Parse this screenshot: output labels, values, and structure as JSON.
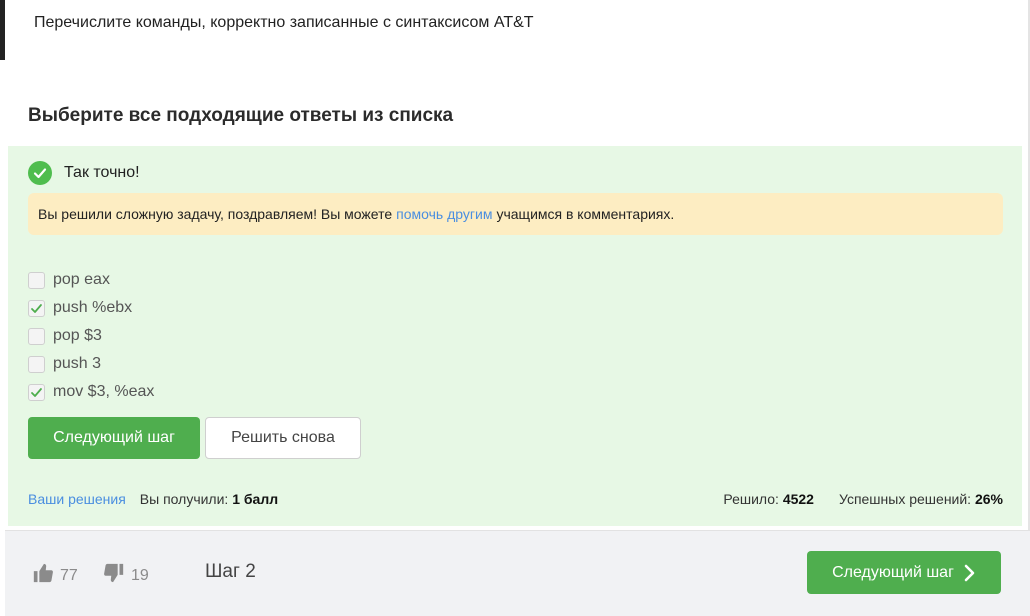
{
  "question": {
    "text": "Перечислите команды, корректно записанные с синтаксисом AT&T"
  },
  "task": {
    "title": "Выберите все подходящие ответы из списка"
  },
  "result": {
    "status_text": "Так точно!",
    "notice_before": "Вы решили сложную задачу, поздравляем! Вы можете",
    "notice_link": "помочь другим",
    "notice_after": "учащимся в комментариях."
  },
  "options": [
    {
      "label": "pop eax",
      "checked": false
    },
    {
      "label": "push %ebx",
      "checked": true
    },
    {
      "label": "pop $3",
      "checked": false
    },
    {
      "label": "push 3",
      "checked": false
    },
    {
      "label": "mov $3, %eax",
      "checked": true
    }
  ],
  "buttons": {
    "next_step": "Следующий шаг",
    "solve_again": "Решить снова"
  },
  "stats": {
    "your_solutions_link": "Ваши решения",
    "received_label": "Вы получили:",
    "received_value": "1 балл",
    "solved_label": "Решило:",
    "solved_value": "4522",
    "success_label": "Успешных решений:",
    "success_value": "26%"
  },
  "footer": {
    "likes": "77",
    "dislikes": "19",
    "step_label": "Шаг 2",
    "next_step": "Следующий шаг"
  },
  "icons": {
    "like": "thumbs-up-icon",
    "dislike": "thumbs-down-icon",
    "correct": "check-circle-icon",
    "next": "chevron-right-icon"
  },
  "colors": {
    "accent_green": "#4fae4e",
    "success_bg": "#e7f8e5",
    "notice_bg": "#fdedc2",
    "link": "#4a8ee0"
  }
}
